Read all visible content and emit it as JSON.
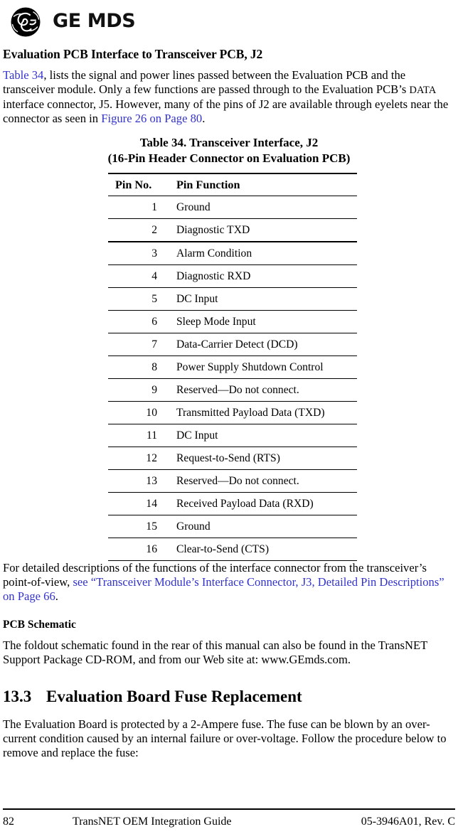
{
  "header": {
    "logo_icon": "ge-monogram-icon",
    "brand": "GE MDS"
  },
  "subheading": "Evaluation PCB Interface to Transceiver PCB, J2",
  "intro": {
    "link_table": "Table 34",
    "part1": ", lists the signal and power lines passed between the Evaluation PCB and the transceiver module. Only a few functions are passed through to the Evaluation PCB’s ",
    "smallcaps": "DATA",
    "part2": " interface connector, J5. However, many of the pins of J2 are available through eyelets near the connector as seen in ",
    "link_figure": "Figure 26 on Page 80",
    "part3": "."
  },
  "table": {
    "caption_line1": "Table 34. Transceiver Interface, J2",
    "caption_line2": "(16-Pin Header Connector on Evaluation PCB)",
    "columns": [
      "Pin No.",
      "Pin Function"
    ],
    "rows": [
      [
        "1",
        "Ground"
      ],
      [
        "2",
        "Diagnostic TXD"
      ],
      [
        "3",
        "Alarm Condition"
      ],
      [
        "4",
        "Diagnostic RXD"
      ],
      [
        "5",
        "DC Input"
      ],
      [
        "6",
        "Sleep Mode Input"
      ],
      [
        "7",
        "Data-Carrier Detect (DCD)"
      ],
      [
        "8",
        "Power Supply Shutdown Control"
      ],
      [
        "9",
        "Reserved—Do not connect."
      ],
      [
        "10",
        "Transmitted Payload Data (TXD)"
      ],
      [
        "11",
        "DC Input"
      ],
      [
        "12",
        "Request-to-Send (RTS)"
      ],
      [
        "13",
        "Reserved—Do not connect."
      ],
      [
        "14",
        "Received Payload Data (RXD)"
      ],
      [
        "15",
        "Ground"
      ],
      [
        "16",
        "Clear-to-Send (CTS)"
      ]
    ]
  },
  "after_table": {
    "part1": "For detailed descriptions of the functions of the interface connector from the transceiver’s point-of-view, ",
    "link": "see “Transceiver Module’s Interface Connector, J3, Detailed Pin Descriptions” on Page 66",
    "part2": "."
  },
  "pcb_schematic": {
    "heading": "PCB Schematic",
    "body": "The foldout schematic found in the rear of this manual can also be found in the TransNET Support Package CD-ROM, and from our Web site at: www.GEmds.com."
  },
  "section": {
    "number": "13.3",
    "title": "Evaluation Board Fuse Replacement",
    "body": "The Evaluation Board is protected by a 2-Ampere fuse. The fuse can be blown by an over-current condition caused by an internal failure or over-voltage. Follow the procedure below to remove and replace the fuse:"
  },
  "footer": {
    "page_number": "82",
    "title": "TransNET OEM Integration Guide",
    "doc_id": "05-3946A01, Rev. C"
  },
  "colors": {
    "link": "#3333cc",
    "text": "#000000",
    "rule": "#000000"
  }
}
